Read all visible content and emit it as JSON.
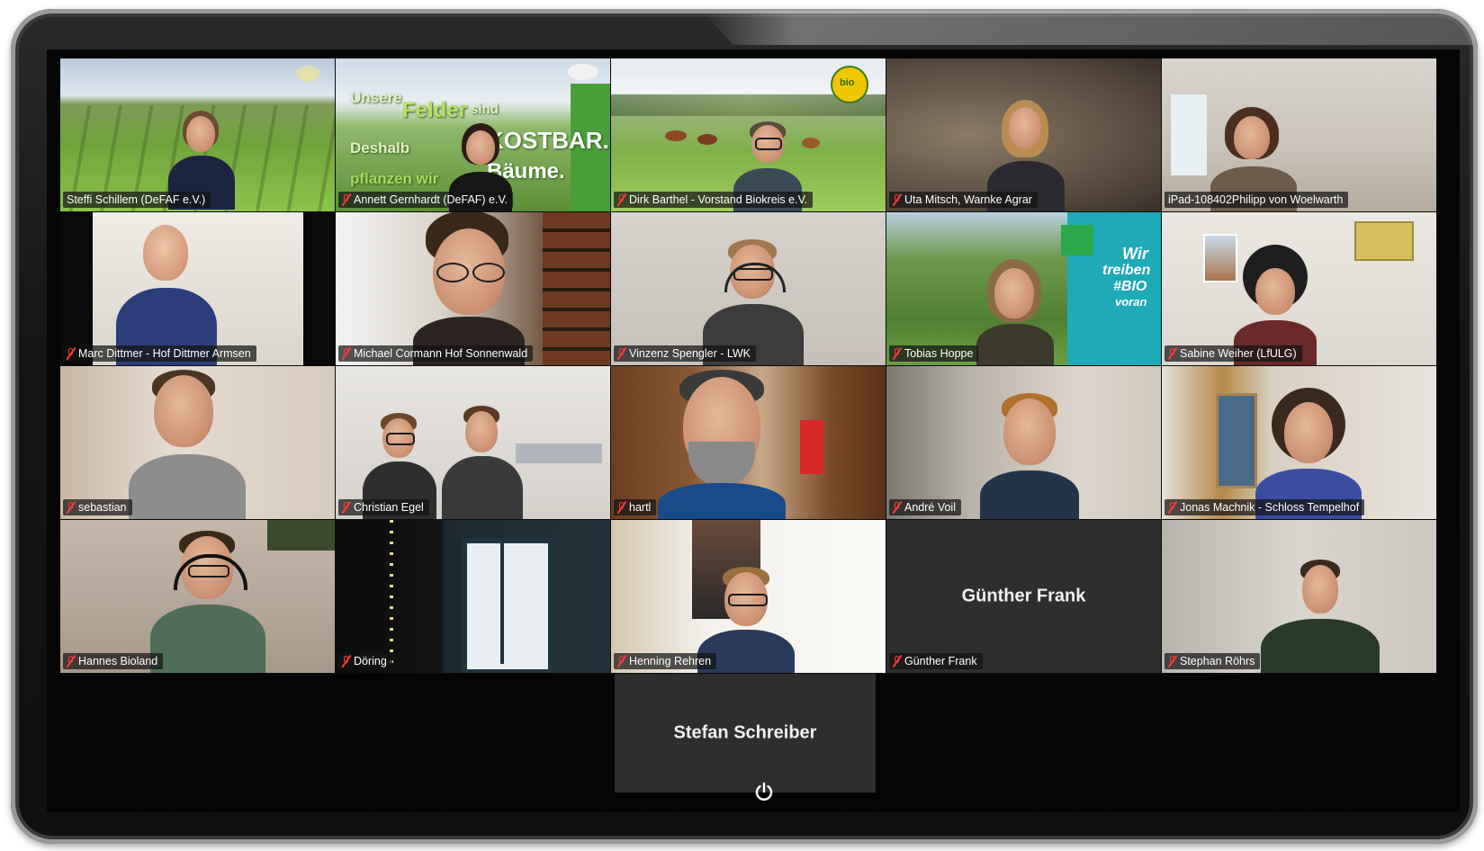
{
  "meeting": {
    "participants": [
      {
        "name": "Steffi Schillem (DeFAF e.V.)",
        "muted": false,
        "active": true
      },
      {
        "name": "Annett Gernhardt (DeFAF) e.V.",
        "muted": true,
        "banner": {
          "line1": "Unsere",
          "line2": "Felder",
          "line3": "sind",
          "line4": "KOSTBAR.",
          "line5": "Deshalb",
          "line6": "pflanzen wir",
          "line7": "Bäume."
        }
      },
      {
        "name": "Dirk Barthel - Vorstand Biokreis e.V.",
        "muted": true,
        "logo": "bio"
      },
      {
        "name": "Uta Mitsch, Warnke Agrar",
        "muted": true
      },
      {
        "name": "iPad-108402Philipp von Woelwarth",
        "muted": false
      },
      {
        "name": "Marc Dittmer - Hof Dittmer Armsen",
        "muted": true
      },
      {
        "name": "Michael Cormann Hof Sonnenwald",
        "muted": true
      },
      {
        "name": "Vinzenz Spengler - LWK",
        "muted": true
      },
      {
        "name": "Tobias Hoppe",
        "muted": true,
        "banner": {
          "line1": "Wir",
          "line2": "treiben",
          "line3": "#BIO",
          "line4": "voran"
        }
      },
      {
        "name": "Sabine Weiher (LfULG)",
        "muted": true
      },
      {
        "name": "sebastian",
        "muted": true
      },
      {
        "name": "Christian Egel",
        "muted": true
      },
      {
        "name": "hartl",
        "muted": true
      },
      {
        "name": "André Voil",
        "muted": true
      },
      {
        "name": "Jonas Machnik - Schloss Tempelhof",
        "muted": true
      },
      {
        "name": "Hannes Bioland",
        "muted": true
      },
      {
        "name": "Döring",
        "muted": true
      },
      {
        "name": "Henning Rehren",
        "muted": true
      },
      {
        "name": "Günther Frank",
        "muted": true,
        "video_off_label": "Günther Frank"
      },
      {
        "name": "Stephan Röhrs",
        "muted": true
      }
    ],
    "extra_participant": {
      "video_off_label": "Stefan Schreiber"
    },
    "power_icon": "power-icon",
    "colors": {
      "active_border": "#b6e85b",
      "muted_mic": "#ff3b3b",
      "video_off_bg": "#2e2e2e",
      "bezel": "#151515"
    }
  }
}
